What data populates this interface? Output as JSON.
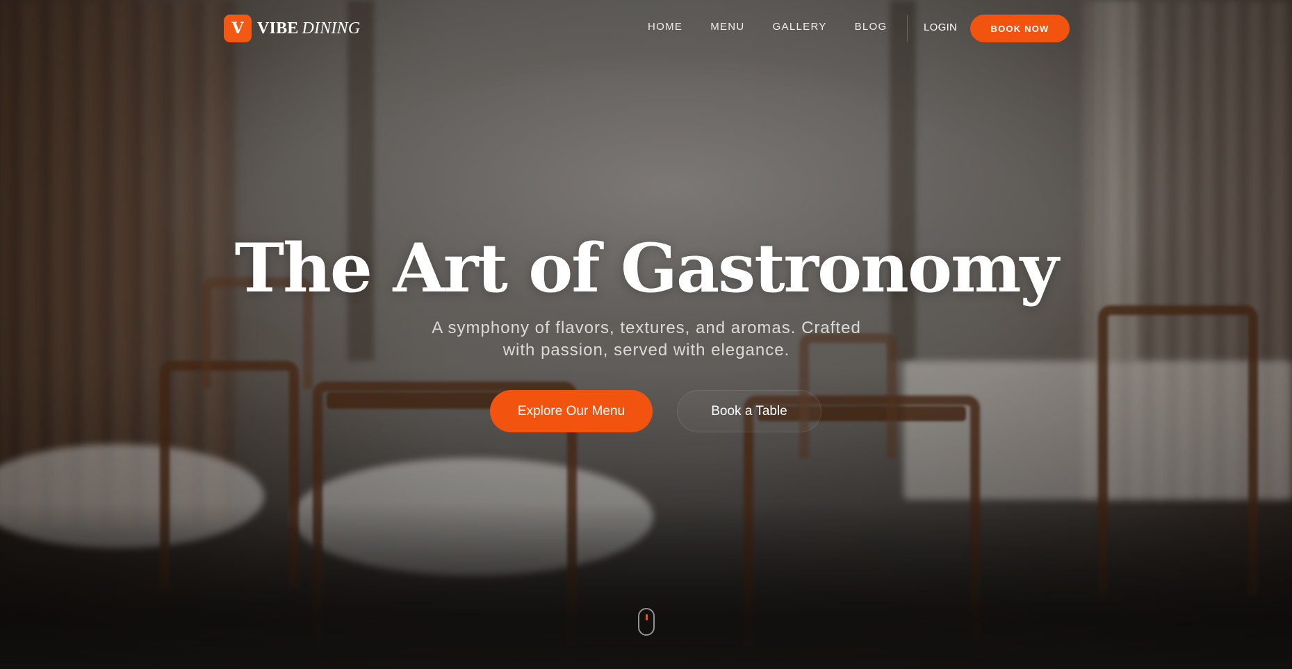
{
  "brand": {
    "badge_letter": "V",
    "name_bold": "VIBE",
    "name_italic": "DINING",
    "accent_color": "#f25410"
  },
  "nav": {
    "links": [
      "HOME",
      "MENU",
      "GALLERY",
      "BLOG"
    ],
    "login_label": "LOGIN",
    "book_now_label": "BOOK NOW"
  },
  "hero": {
    "title": "The Art of Gastronomy",
    "subtitle": "A symphony of flavors, textures, and aromas. Crafted with passion, served with elegance.",
    "primary_cta": "Explore Our Menu",
    "secondary_cta": "Book a Table",
    "background": "blurred-restaurant-dining-room-photo"
  },
  "icons": {
    "scroll_indicator": "mouse-scroll-icon"
  }
}
